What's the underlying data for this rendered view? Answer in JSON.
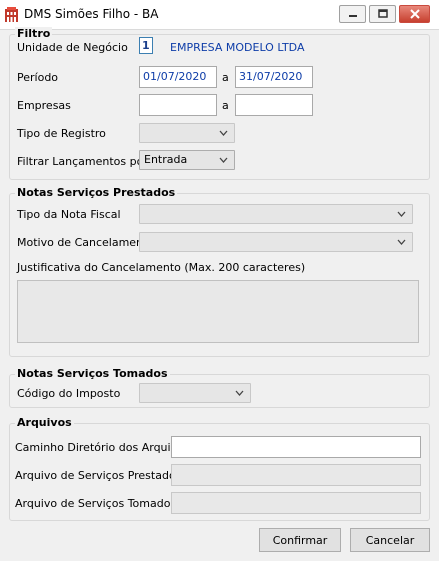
{
  "window": {
    "title": "DMS Simões Filho - BA",
    "icons": {
      "app": "building-icon",
      "minimize": "minimize-icon",
      "maximize": "maximize-icon",
      "close": "close-icon"
    }
  },
  "filtro": {
    "legend": "Filtro",
    "unidade_label": "Unidade de Negócio",
    "unidade_code": "1",
    "unidade_name": "EMPRESA MODELO LTDA",
    "periodo_label": "Período",
    "periodo_start": "01/07/2020",
    "periodo_sep": "a",
    "periodo_end": "31/07/2020",
    "empresas_label": "Empresas",
    "empresas_start": "",
    "empresas_sep": "a",
    "empresas_end": "",
    "tipo_registro_label": "Tipo de Registro",
    "tipo_registro_value": "",
    "filtrar_label": "Filtrar Lançamentos por",
    "filtrar_value": "Entrada"
  },
  "prestados": {
    "legend": "Notas Serviços Prestados",
    "tipo_nota_label": "Tipo da Nota Fiscal",
    "tipo_nota_value": "",
    "motivo_label": "Motivo de Cancelamento",
    "motivo_value": "",
    "justificativa_label": "Justificativa do Cancelamento (Max. 200 caracteres)",
    "justificativa_value": ""
  },
  "tomados": {
    "legend": "Notas Serviços Tomados",
    "codigo_label": "Código do Imposto",
    "codigo_value": ""
  },
  "arquivos": {
    "legend": "Arquivos",
    "caminho_label": "Caminho Diretório dos Arquivos",
    "caminho_value": "",
    "prestados_label": "Arquivo de Serviços Prestados",
    "prestados_value": "",
    "tomados_label": "Arquivo de Serviços Tomados",
    "tomados_value": ""
  },
  "buttons": {
    "confirmar": "Confirmar",
    "cancelar": "Cancelar"
  },
  "colors": {
    "accent_text": "#0e3da8",
    "close_button": "#c7402f",
    "window_bg": "#f0f0f0"
  }
}
